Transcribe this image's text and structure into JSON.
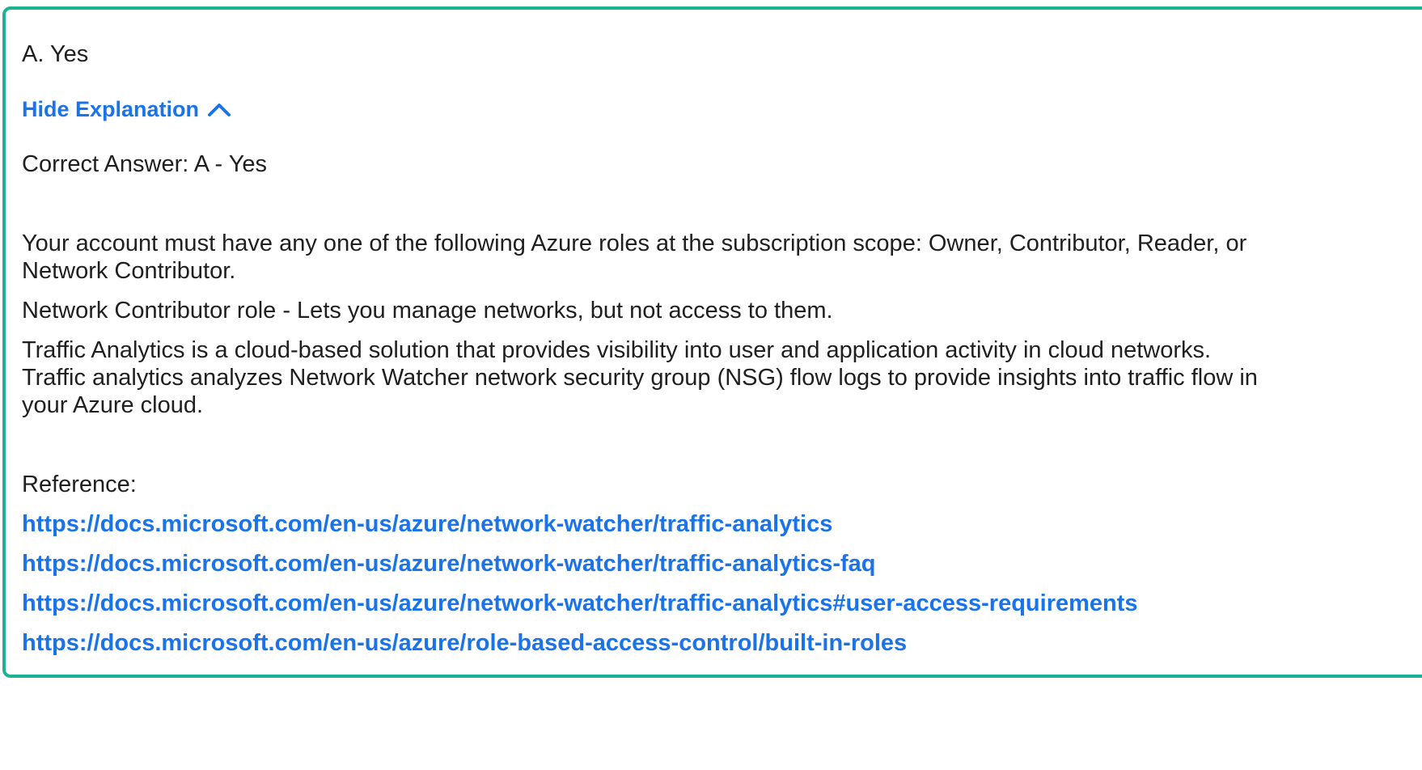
{
  "answer": {
    "selected": "A. Yes"
  },
  "explanation": {
    "toggle_label": "Hide Explanation",
    "toggle_icon": "chevron-up-icon",
    "correct_answer": "Correct Answer: A - Yes",
    "paragraphs": [
      "Your account must have any one of the following Azure roles at the subscription scope: Owner, Contributor, Reader, or Network Contributor.",
      "Network Contributor role - Lets you manage networks, but not access to them.",
      "Traffic Analytics is a cloud-based solution that provides visibility into user and application activity in cloud networks. Traffic analytics analyzes Network Watcher network security group (NSG) flow logs to provide insights into traffic flow in your Azure cloud."
    ],
    "reference_label": "Reference:",
    "links": [
      "https://docs.microsoft.com/en-us/azure/network-watcher/traffic-analytics",
      "https://docs.microsoft.com/en-us/azure/network-watcher/traffic-analytics-faq",
      "https://docs.microsoft.com/en-us/azure/network-watcher/traffic-analytics#user-access-requirements",
      "https://docs.microsoft.com/en-us/azure/role-based-access-control/built-in-roles"
    ]
  },
  "colors": {
    "border": "#1cb394",
    "link": "#1a73e8",
    "text": "#1f1f1f"
  }
}
